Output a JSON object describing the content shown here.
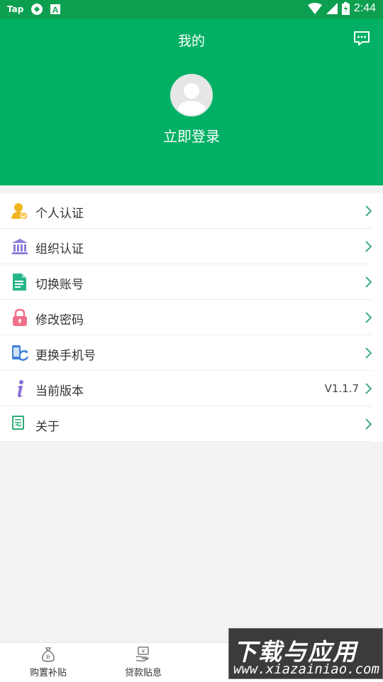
{
  "statusbar": {
    "carrier": "Tap",
    "time": "2:44"
  },
  "header": {
    "title": "我的",
    "login_label": "立即登录"
  },
  "menu": {
    "items": [
      {
        "label": "个人认证",
        "icon": "user-verified-icon",
        "value": ""
      },
      {
        "label": "组织认证",
        "icon": "bank-building-icon",
        "value": ""
      },
      {
        "label": "切换账号",
        "icon": "document-icon",
        "value": ""
      },
      {
        "label": "修改密码",
        "icon": "lock-icon",
        "value": ""
      },
      {
        "label": "更换手机号",
        "icon": "phone-sync-icon",
        "value": ""
      },
      {
        "label": "当前版本",
        "icon": "info-icon",
        "value": "V1.1.7"
      },
      {
        "label": "关于",
        "icon": "about-doc-icon",
        "value": ""
      }
    ]
  },
  "tabs": [
    {
      "label": "购置补贴",
      "icon": "subsidy-bag-icon"
    },
    {
      "label": "贷款贴息",
      "icon": "loan-hand-icon"
    }
  ],
  "watermark": {
    "line1": "下载与应用",
    "line2": "www.xiazainiao.com"
  },
  "colors": {
    "header_green": "#01b064",
    "statusbar_green": "#0d9f50",
    "chevron": "#2aa37a"
  }
}
